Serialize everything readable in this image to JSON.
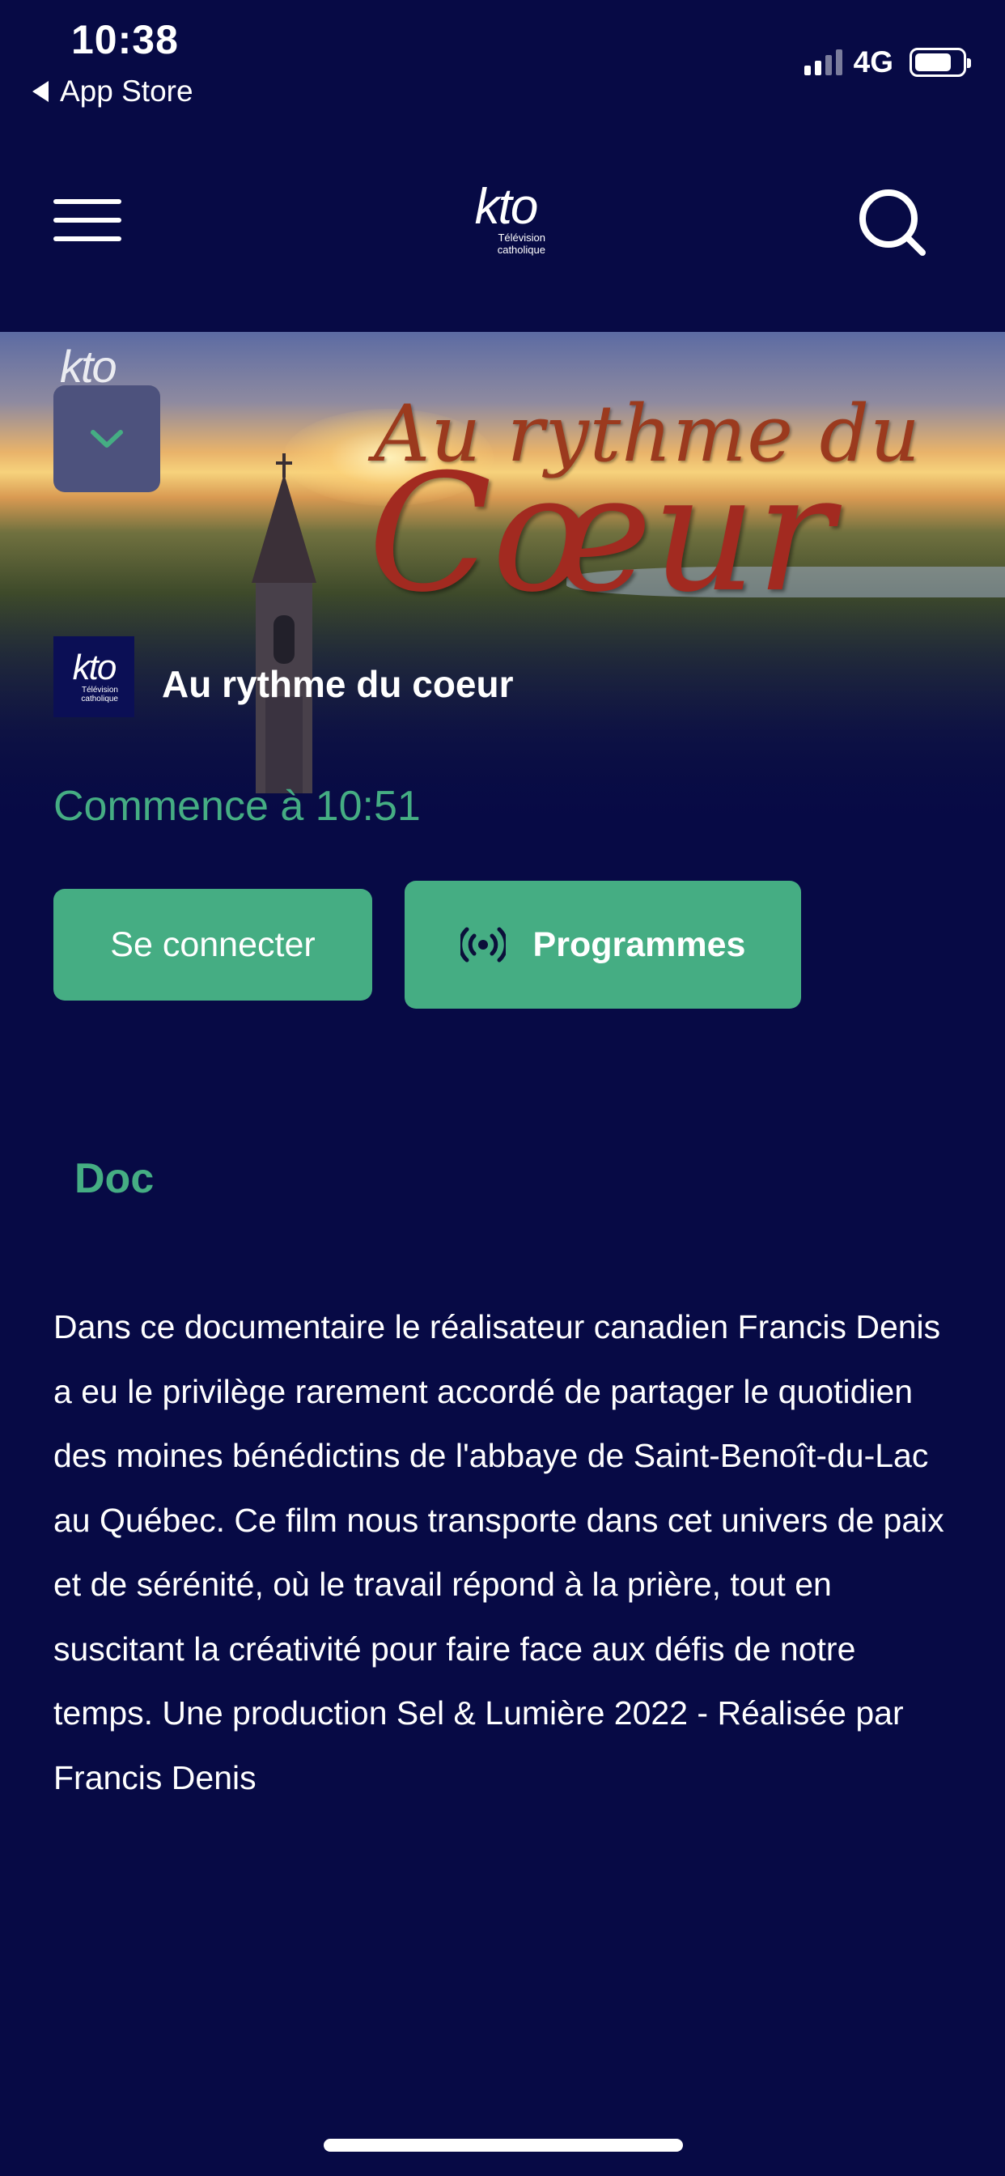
{
  "status_bar": {
    "time": "10:38",
    "back_label": "App Store",
    "network": "4G"
  },
  "nav": {
    "brand_mark": "kto",
    "brand_sub_line1": "Télévision",
    "brand_sub_line2": "catholique",
    "menu_icon": "hamburger-icon",
    "search_icon": "search-icon"
  },
  "hero": {
    "title_line1": "Au rythme du",
    "title_line2": "Cœur",
    "watermark": "kto"
  },
  "program": {
    "channel_mark": "kto",
    "channel_sub_line1": "Télévision",
    "channel_sub_line2": "catholique",
    "title": "Au rythme du coeur",
    "starts_at": "Commence à 10:51",
    "genre": "Doc",
    "description": "Dans ce documentaire le réalisateur canadien Francis Denis a eu le privilège rarement accordé de partager le quotidien des moines bénédictins de l'abbaye de Saint-Benoît-du-Lac au Québec. Ce film nous transporte dans cet univers de paix et de sérénité, où le travail répond à la prière, tout en suscitant la créativité pour faire face aux défis de notre temps. Une production Sel & Lumière 2022 - Réalisée par Francis Denis"
  },
  "actions": {
    "login_label": "Se connecter",
    "programs_label": "Programmes",
    "programs_icon": "broadcast-icon"
  },
  "colors": {
    "background": "#070a45",
    "accent": "#45ad83",
    "collapse_button": "#4d527d"
  }
}
